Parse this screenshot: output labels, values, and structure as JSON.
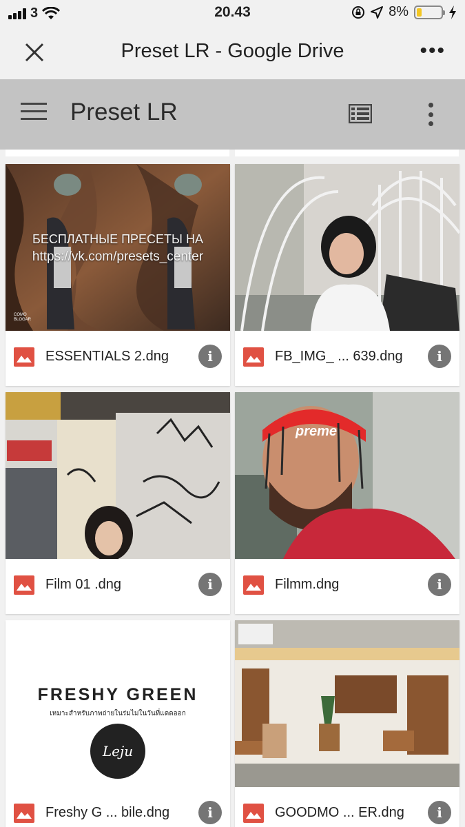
{
  "status_bar": {
    "carrier": "3",
    "time": "20.43",
    "battery_percent": "8%",
    "battery_level": 0.08,
    "battery_color": "#f3c623"
  },
  "browser": {
    "title": "Preset LR - Google Drive",
    "close_icon": "close-icon",
    "more_icon": "more-horizontal-icon"
  },
  "app_bar": {
    "title": "Preset LR",
    "background": "#c3c3c3",
    "menu_icon": "hamburger-menu-icon",
    "list_view_icon": "list-view-icon",
    "more_icon": "more-vertical-icon"
  },
  "files": [
    {
      "name": "ESSENTIALS 2.dng",
      "overlay_line1": "БЕСПЛАТНЫЕ ПРЕСЕТЫ НА",
      "overlay_line2": "https://vk.com/presets_center",
      "watermark": "COMO BLOGAR"
    },
    {
      "name": "FB_IMG_ ... 639.dng"
    },
    {
      "name": "Film 01 .dng"
    },
    {
      "name": "Filmm.dng",
      "cap_text": "preme"
    },
    {
      "name": "Freshy G ... bile.dng",
      "thumb_title": "FRESHY GREEN",
      "thumb_subtitle": "เหมาะสำหรับภาพถ่ายในร่มไม่ในวันที่แดดออก",
      "thumb_logo": "Leju"
    },
    {
      "name": "GOODMO ... ER.dng"
    }
  ],
  "file_icon": "image-file-icon",
  "info_icon": "info-icon",
  "info_glyph": "i",
  "accent_color": "#e05143"
}
